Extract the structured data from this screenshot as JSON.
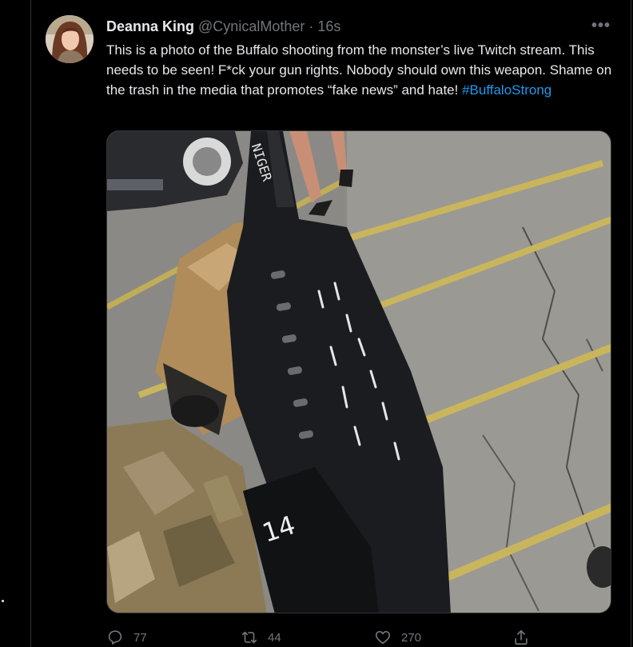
{
  "tweet": {
    "author_name": "Deanna King",
    "author_handle": "@CynicalMother",
    "separator": "·",
    "time": "16s",
    "more_label": "•••",
    "text": "This is a photo of the Buffalo shooting from the monster’s live Twitch stream. This needs to be seen! F*ck your gun rights. Nobody should own this weapon. Shame on the trash in the media that promotes  “fake news” and hate! ",
    "hashtag": "#BuffaloStrong",
    "media_caption_mark": "14",
    "media_barrel_mark": "NIGER"
  },
  "actions": {
    "reply": {
      "icon": "reply-icon",
      "count": "77"
    },
    "retweet": {
      "icon": "retweet-icon",
      "count": "44"
    },
    "like": {
      "icon": "heart-icon",
      "count": "270"
    },
    "share": {
      "icon": "share-icon"
    }
  },
  "colors": {
    "background": "#000000",
    "text": "#e7e9ea",
    "muted": "#71767b",
    "link": "#1d9bf0",
    "border": "#2f3336"
  }
}
